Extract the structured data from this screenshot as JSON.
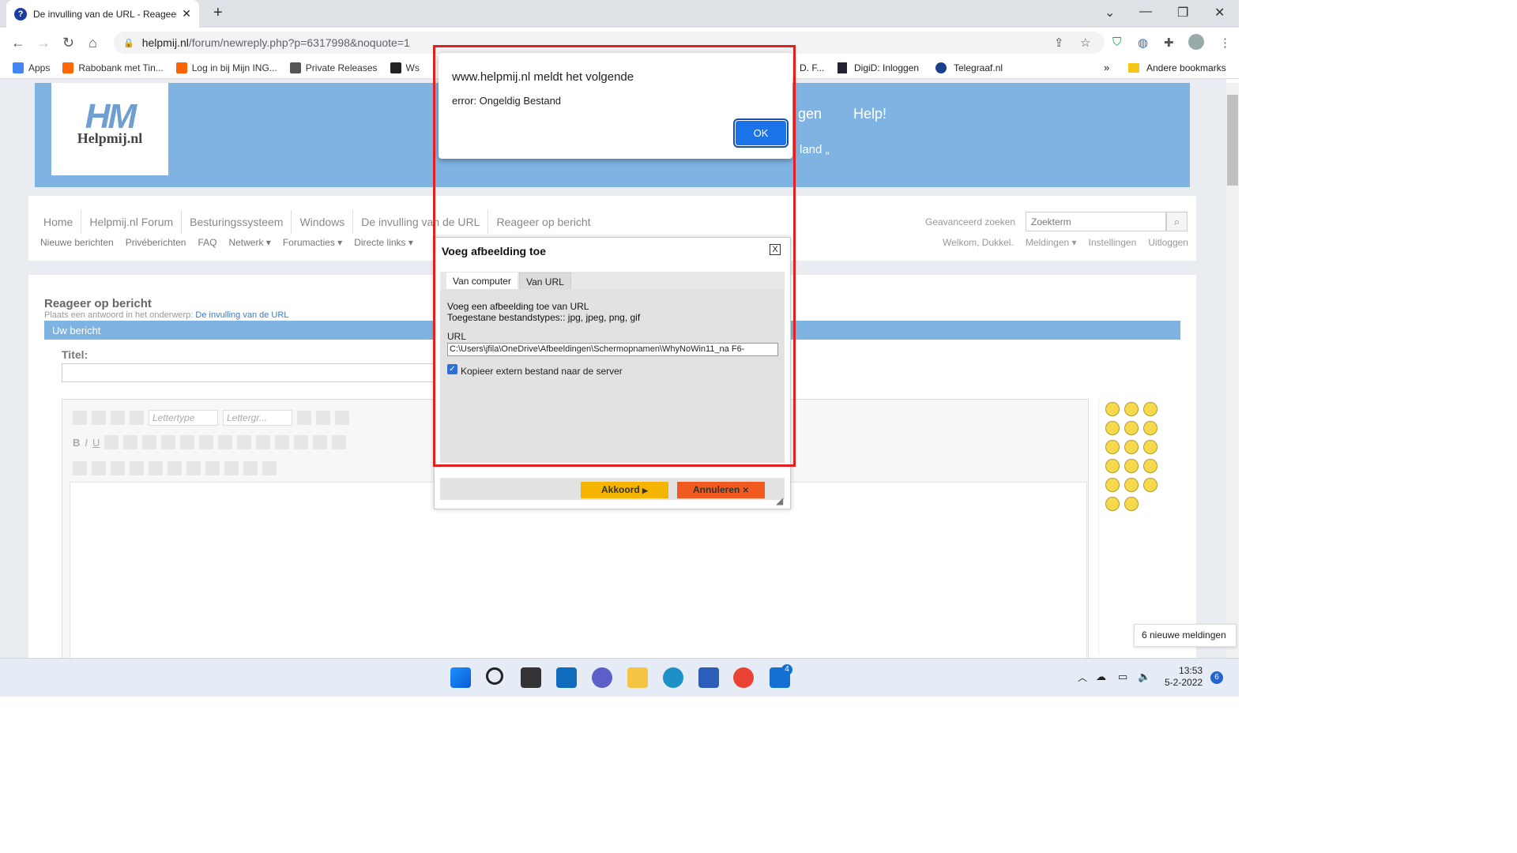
{
  "browser": {
    "tab_title": "De invulling van de URL - Reageer",
    "url_domain": "helpmij.nl",
    "url_path": "/forum/newreply.php?p=6317998&noquote=1",
    "bookmarks": [
      "Apps",
      "Rabobank met Tin...",
      "Log in bij Mijn ING...",
      "Private Releases",
      "Ws",
      "D. F...",
      "DigiD: Inloggen",
      "Telegraaf.nl"
    ],
    "overflow": "»",
    "other_bookmarks": "Andere bookmarks"
  },
  "site": {
    "logo": "HM",
    "logo_text": "Helpmij.nl",
    "banner_menu": "Help!",
    "banner_fragment_1": "gen",
    "banner_fragment_2": "land „",
    "breadcrumbs": [
      "Home",
      "Helpmij.nl Forum",
      "Besturingssysteem",
      "Windows",
      "De invulling van de URL",
      "Reageer op bericht"
    ],
    "submenu": [
      "Nieuwe berichten",
      "Privéberichten",
      "FAQ",
      "Netwerk ▾",
      "Forumacties ▾",
      "Directe links ▾"
    ],
    "advanced_search": "Geavanceerd zoeken",
    "search_placeholder": "Zoekterm",
    "user_links": [
      "Welkom, Dukkel.",
      "Meldingen ▾",
      "Instellingen",
      "Uitloggen"
    ]
  },
  "reply": {
    "heading": "Reageer op bericht",
    "subtitle": "Plaats een antwoord in het onderwerp:",
    "subject_link": "De invulling van de URL",
    "bar": "Uw bericht",
    "title_label": "Titel:",
    "font_dd": "Lettertype",
    "size_dd": "Lettergr..."
  },
  "image_dialog": {
    "title": "Voeg afbeelding toe",
    "close": "X",
    "tabs": [
      "Van computer",
      "Van URL"
    ],
    "line1": "Voeg een afbeelding toe van URL",
    "line2": "Toegestane bestandstypes:: jpg, jpeg, png, gif",
    "url_label": "URL",
    "url_value": "C:\\Users\\jfila\\OneDrive\\Afbeeldingen\\Schermopnamen\\WhyNoWin11_na F6-",
    "copy_label": "Kopieer extern bestand naar de server",
    "copy_checked": true,
    "ok": "Akkoord",
    "cancel": "Annuleren"
  },
  "alert": {
    "title": "www.helpmij.nl meldt het volgende",
    "message": "error: Ongeldig Bestand",
    "ok": "OK"
  },
  "notification": "6 nieuwe meldingen",
  "taskbar": {
    "time": "13:53",
    "date": "5-2-2022",
    "badge": "6",
    "mail_badge": "4"
  },
  "colors": {
    "banner": "#7eb3e2",
    "alert_ok": "#1a73e8",
    "highlight": "#e1201f",
    "akkoord": "#f5b400",
    "annuleren": "#f05a1e"
  }
}
